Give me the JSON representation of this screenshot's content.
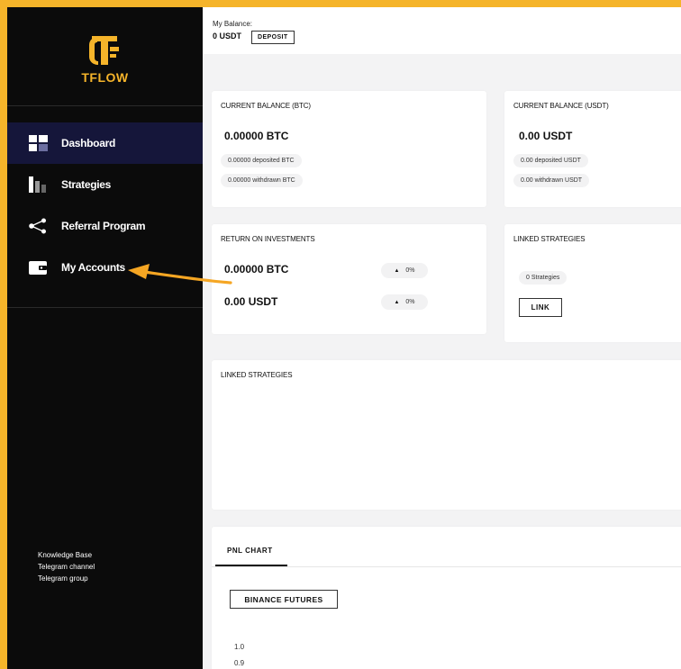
{
  "brand": {
    "name": "TFLOW",
    "accent": "#f5b42a"
  },
  "sidebar": {
    "items": [
      {
        "label": "Dashboard",
        "icon": "dashboard-icon",
        "active": true
      },
      {
        "label": "Strategies",
        "icon": "strategies-icon",
        "active": false
      },
      {
        "label": "Referral Program",
        "icon": "share-icon",
        "active": false
      },
      {
        "label": "My Accounts",
        "icon": "wallet-icon",
        "active": false
      }
    ],
    "links": [
      "Knowledge Base",
      "Telegram channel",
      "Telegram group"
    ]
  },
  "topbar": {
    "balance_label": "My Balance:",
    "balance_value": "0 USDT",
    "deposit_label": "DEPOSIT"
  },
  "cards": {
    "btc": {
      "title": "CURRENT BALANCE (BTC)",
      "value": "0.00000 BTC",
      "deposited": "0.00000 deposited BTC",
      "withdrawn": "0.00000 withdrawn BTC"
    },
    "usdt": {
      "title": "CURRENT BALANCE (USDT)",
      "value": "0.00 USDT",
      "deposited": "0.00 deposited USDT",
      "withdrawn": "0.00 withdrawn USDT"
    },
    "roi": {
      "title": "RETURN ON INVESTMENTS",
      "btc_value": "0.00000 BTC",
      "btc_pct": "0%",
      "usdt_value": "0.00 USDT",
      "usdt_pct": "0%"
    },
    "linked": {
      "title": "LINKED STRATEGIES",
      "count": "0 Strategies",
      "link_label": "LINK"
    },
    "linked_wide": {
      "title": "LINKED STRATEGIES"
    },
    "pnl": {
      "tab": "PNL CHART",
      "exchange_button": "BINANCE FUTURES",
      "y_ticks": [
        "1.0",
        "0.9"
      ]
    }
  }
}
